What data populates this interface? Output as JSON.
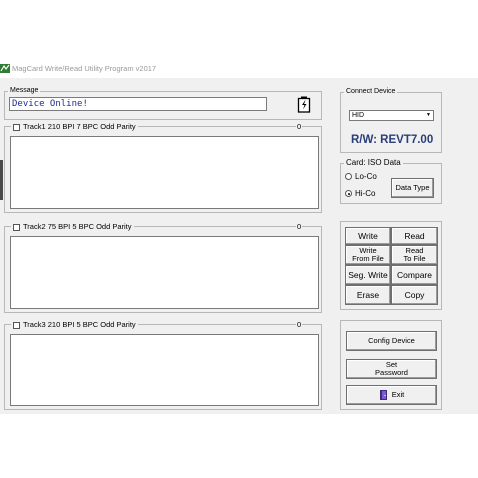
{
  "window": {
    "title": "MagCard Write/Read Utility Program  v2017"
  },
  "message": {
    "label": "Message",
    "text": "Device Online!"
  },
  "tracks": [
    {
      "label": "Track1   210 BPI  7 BPC  Odd Parity",
      "count": "0"
    },
    {
      "label": "Track2   75 BPI  5 BPC  Odd Parity",
      "count": "0"
    },
    {
      "label": "Track3   210 BPI  5 BPC  Odd Parity",
      "count": "0"
    }
  ],
  "connect": {
    "label": "Connect Device",
    "selected": "HID",
    "status": "R/W: REVT7.00"
  },
  "card": {
    "label": "Card: ISO Data",
    "lo_co": "Lo-Co",
    "hi_co": "Hi-Co",
    "selected": "Hi-Co",
    "data_type": "Data Type"
  },
  "actions": {
    "write": "Write",
    "read": "Read",
    "write_from_file_1": "Write",
    "write_from_file_2": "From File",
    "read_to_file_1": "Read",
    "read_to_file_2": "To File",
    "seg_write": "Seg. Write",
    "compare": "Compare",
    "erase": "Erase",
    "copy": "Copy"
  },
  "config": {
    "config_device": "Config Device",
    "set_password_1": "Set",
    "set_password_2": "Password",
    "exit": "Exit"
  }
}
